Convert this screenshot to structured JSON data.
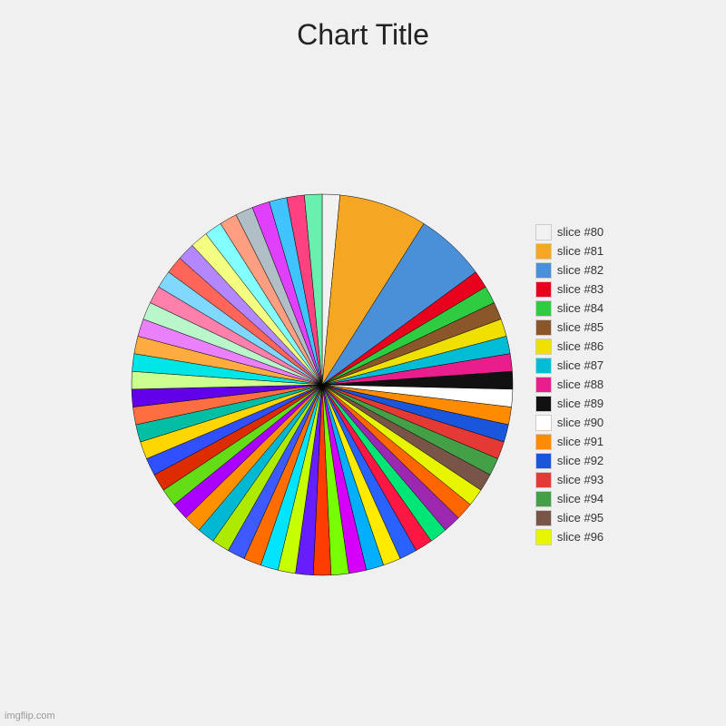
{
  "title": "Chart Title",
  "watermark": "imgflip.com",
  "legend": [
    {
      "label": "slice #80",
      "color": "#f2f2f2"
    },
    {
      "label": "slice #81",
      "color": "#f5a623"
    },
    {
      "label": "slice #82",
      "color": "#4a90d9"
    },
    {
      "label": "slice #83",
      "color": "#e8001c"
    },
    {
      "label": "slice #84",
      "color": "#2ecc40"
    },
    {
      "label": "slice #85",
      "color": "#8b572a"
    },
    {
      "label": "slice #86",
      "color": "#f0e000"
    },
    {
      "label": "slice #87",
      "color": "#00bcd4"
    },
    {
      "label": "slice #88",
      "color": "#e91e8c"
    },
    {
      "label": "slice #89",
      "color": "#111111"
    },
    {
      "label": "slice #90",
      "color": "#ffffff"
    },
    {
      "label": "slice #91",
      "color": "#ff8c00"
    },
    {
      "label": "slice #92",
      "color": "#1a56db"
    },
    {
      "label": "slice #93",
      "color": "#e53935"
    },
    {
      "label": "slice #94",
      "color": "#43a047"
    },
    {
      "label": "slice #95",
      "color": "#795548"
    },
    {
      "label": "slice #96",
      "color": "#e8f500"
    }
  ],
  "slices": [
    {
      "color": "#f2f2f2"
    },
    {
      "color": "#f5a623"
    },
    {
      "color": "#4a90d9"
    },
    {
      "color": "#e8001c"
    },
    {
      "color": "#2ecc40"
    },
    {
      "color": "#8b572a"
    },
    {
      "color": "#f0e000"
    },
    {
      "color": "#00bcd4"
    },
    {
      "color": "#e91e8c"
    },
    {
      "color": "#111111"
    },
    {
      "color": "#ffffff"
    },
    {
      "color": "#ff8c00"
    },
    {
      "color": "#1a56db"
    },
    {
      "color": "#e53935"
    },
    {
      "color": "#43a047"
    },
    {
      "color": "#795548"
    },
    {
      "color": "#e8f500"
    },
    {
      "color": "#ff6600"
    },
    {
      "color": "#9c27b0"
    },
    {
      "color": "#00e676"
    },
    {
      "color": "#ff1744"
    },
    {
      "color": "#2962ff"
    },
    {
      "color": "#ffea00"
    },
    {
      "color": "#00b0ff"
    },
    {
      "color": "#d500f9"
    },
    {
      "color": "#76ff03"
    },
    {
      "color": "#ff3d00"
    },
    {
      "color": "#651fff"
    },
    {
      "color": "#c6ff00"
    },
    {
      "color": "#00e5ff"
    },
    {
      "color": "#ff6d00"
    },
    {
      "color": "#3d5afe"
    },
    {
      "color": "#aeea00"
    },
    {
      "color": "#00b8d4"
    },
    {
      "color": "#ff9100"
    },
    {
      "color": "#aa00ff"
    },
    {
      "color": "#64dd17"
    },
    {
      "color": "#dd2c00"
    },
    {
      "color": "#304ffe"
    },
    {
      "color": "#ffd600"
    },
    {
      "color": "#00bfa5"
    },
    {
      "color": "#ff6e40"
    },
    {
      "color": "#6200ea"
    },
    {
      "color": "#ccff90"
    },
    {
      "color": "#00e5e5"
    },
    {
      "color": "#ffab40"
    },
    {
      "color": "#ea80fc"
    },
    {
      "color": "#b9f6ca"
    },
    {
      "color": "#ff80ab"
    },
    {
      "color": "#80d8ff"
    },
    {
      "color": "#ff6659"
    },
    {
      "color": "#b388ff"
    },
    {
      "color": "#f4ff81"
    },
    {
      "color": "#84ffff"
    },
    {
      "color": "#ff9e80"
    },
    {
      "color": "#b0bec5"
    },
    {
      "color": "#e040fb"
    },
    {
      "color": "#40c4ff"
    },
    {
      "color": "#ff4081"
    },
    {
      "color": "#69f0ae"
    }
  ]
}
